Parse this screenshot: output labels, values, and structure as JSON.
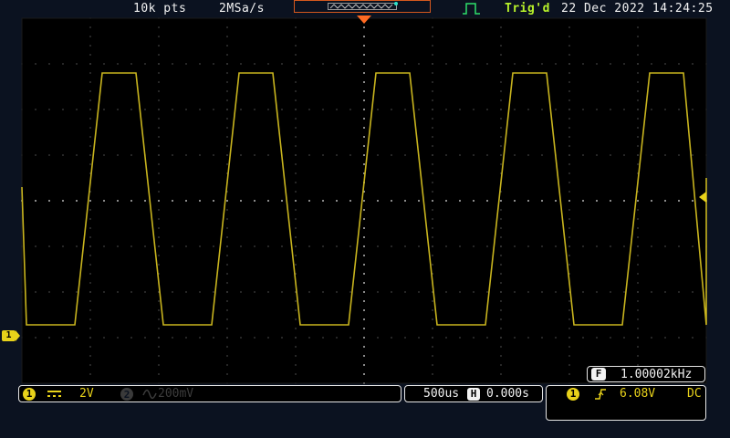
{
  "header": {
    "record_length": "10k pts",
    "sample_rate": "2MSa/s",
    "trigger_status": "Trig'd",
    "date_time": "22 Dec 2022 14:24:25"
  },
  "channel1": {
    "label": "1",
    "coupling_icon": "dc-coupling-icon",
    "scale": "2V",
    "color": "#e8d21a"
  },
  "channel2": {
    "label": "2",
    "coupling_icon": "ac-coupling-icon",
    "scale": "200mV",
    "enabled": false
  },
  "timebase": {
    "scale": "500us",
    "position_label": "H",
    "position": "0.000s"
  },
  "trigger": {
    "source_label": "1",
    "slope_icon": "rising-edge-icon",
    "level": "6.08V",
    "coupling": "DC"
  },
  "measurement": {
    "label": "F",
    "frequency": "1.00002kHz"
  },
  "colors": {
    "background": "#0b1220",
    "grid": "#000000",
    "trace": "#c8b41e",
    "accent_orange": "#ff6a22",
    "trig_status": "#b8f22a"
  }
}
